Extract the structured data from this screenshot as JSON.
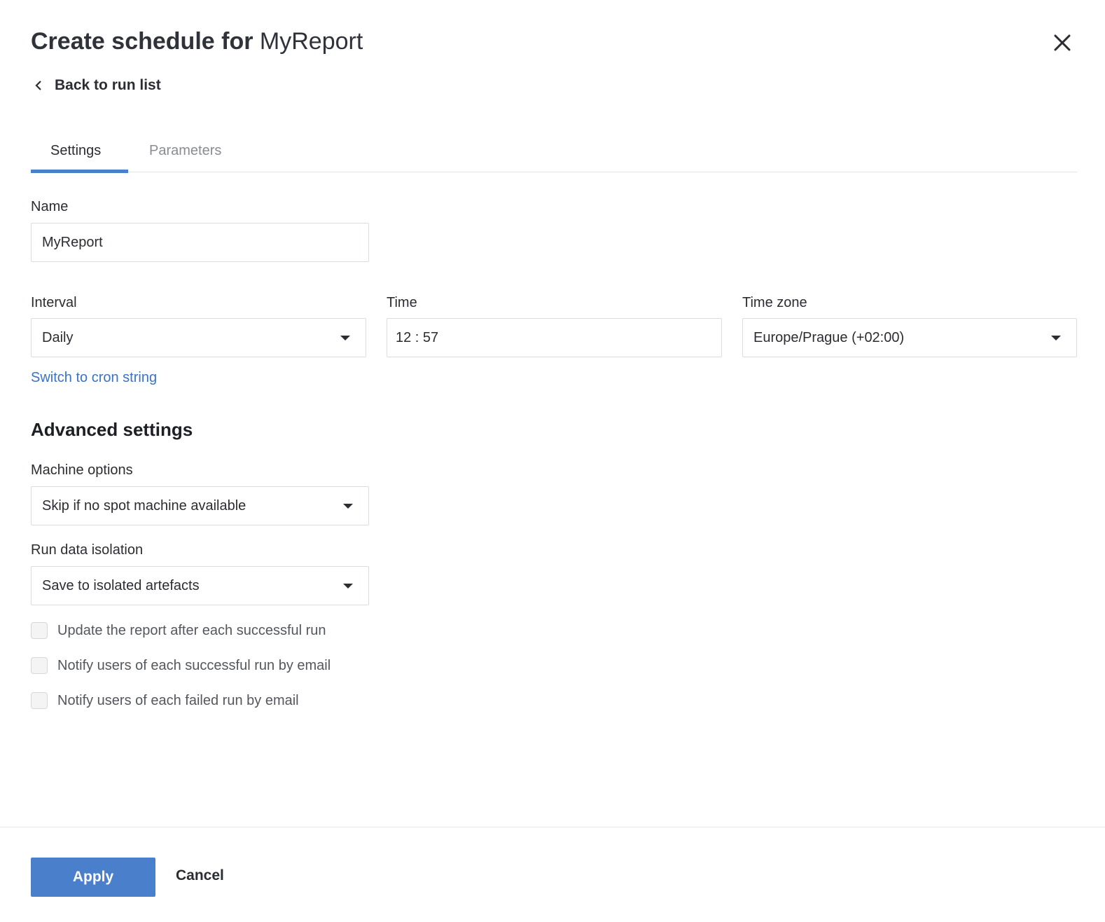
{
  "header": {
    "title_prefix": "Create schedule for",
    "title_name": "MyReport",
    "back_label": "Back to run list"
  },
  "tabs": [
    {
      "label": "Settings",
      "active": true
    },
    {
      "label": "Parameters",
      "active": false
    }
  ],
  "form": {
    "name": {
      "label": "Name",
      "value": "MyReport"
    },
    "interval": {
      "label": "Interval",
      "value": "Daily"
    },
    "time": {
      "label": "Time",
      "value": "12 : 57"
    },
    "timezone": {
      "label": "Time zone",
      "value": "Europe/Prague (+02:00)"
    },
    "cron_link": "Switch to cron string"
  },
  "advanced": {
    "heading": "Advanced settings",
    "machine": {
      "label": "Machine options",
      "value": "Skip if no spot machine available"
    },
    "isolation": {
      "label": "Run data isolation",
      "value": "Save to isolated artefacts"
    },
    "checkboxes": [
      {
        "label": "Update the report after each successful run",
        "checked": false
      },
      {
        "label": "Notify users of each successful run by email",
        "checked": false
      },
      {
        "label": "Notify users of each failed run by email",
        "checked": false
      }
    ]
  },
  "footer": {
    "apply": "Apply",
    "cancel": "Cancel"
  },
  "colors": {
    "accent": "#4a80cb",
    "link": "#3a73c4"
  }
}
